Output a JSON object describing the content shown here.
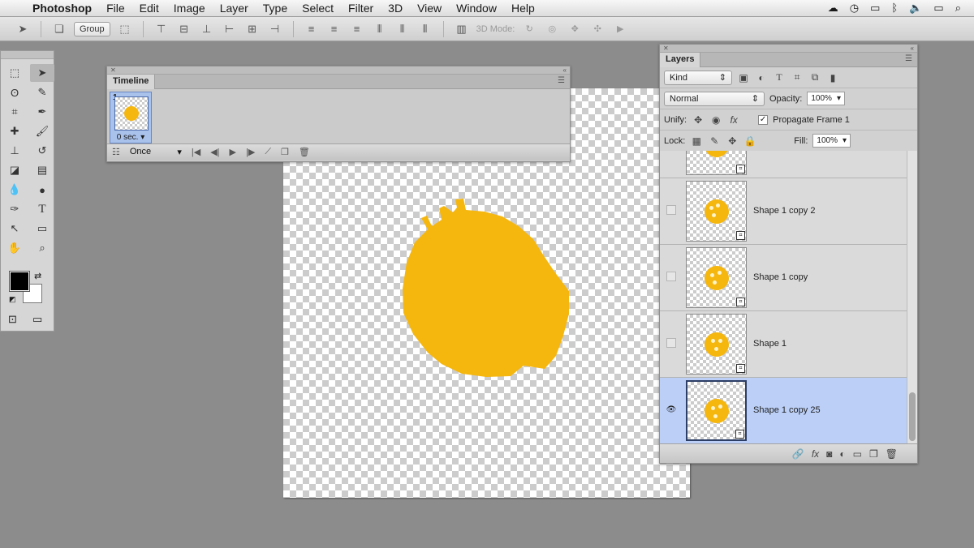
{
  "menubar": {
    "app_name": "Photoshop",
    "items": [
      "File",
      "Edit",
      "Image",
      "Layer",
      "Type",
      "Select",
      "Filter",
      "3D",
      "View",
      "Window",
      "Help"
    ]
  },
  "options_bar": {
    "auto_select_value": "Group",
    "three_d_mode_label": "3D Mode:"
  },
  "timeline": {
    "tab_label": "Timeline",
    "frame_number": "1",
    "frame_delay": "0 sec.",
    "loop_option": "Once"
  },
  "layers_panel": {
    "tab_label": "Layers",
    "filter_kind": "Kind",
    "blend_mode": "Normal",
    "opacity_label": "Opacity:",
    "opacity_value": "100%",
    "unify_label": "Unify:",
    "propagate_label": "Propagate Frame 1",
    "propagate_checked": true,
    "lock_label": "Lock:",
    "fill_label": "Fill:",
    "fill_value": "100%",
    "layers": [
      {
        "name": "Shape 1 copy 2",
        "visible": false,
        "selected": false
      },
      {
        "name": "Shape 1 copy",
        "visible": false,
        "selected": false
      },
      {
        "name": "Shape 1",
        "visible": false,
        "selected": false
      },
      {
        "name": "Shape 1 copy 25",
        "visible": true,
        "selected": true
      }
    ]
  },
  "colors": {
    "shape_fill": "#f5b60e",
    "selection_blue": "#bbcff7",
    "foreground": "#000000",
    "background": "#ffffff"
  }
}
